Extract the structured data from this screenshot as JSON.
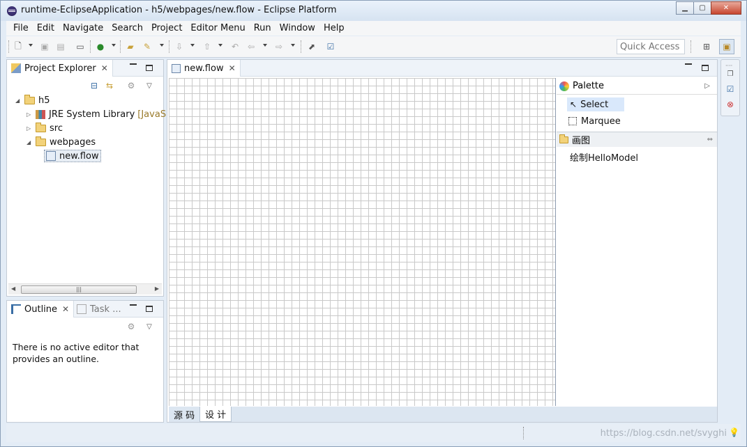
{
  "window": {
    "title": "runtime-EclipseApplication - h5/webpages/new.flow - Eclipse Platform"
  },
  "menu": [
    "File",
    "Edit",
    "Navigate",
    "Search",
    "Project",
    "Editor Menu",
    "Run",
    "Window",
    "Help"
  ],
  "toolbar": {
    "quick_access": "Quick Access"
  },
  "project_explorer": {
    "tab_label": "Project Explorer",
    "tree": {
      "root": "h5",
      "jre": "JRE System Library",
      "jre_decoration": "[JavaSE-",
      "src": "src",
      "webpages": "webpages",
      "file": "new.flow"
    }
  },
  "outline": {
    "tab_label": "Outline",
    "task_tab_label": "Task ...",
    "message": "There is no active editor that provides an outline."
  },
  "editor": {
    "tab_label": "new.flow",
    "palette": {
      "header": "Palette",
      "tools": [
        "Select",
        "Marquee"
      ],
      "drawer_label": "画图",
      "drawer_items": [
        "绘制HelloModel"
      ]
    },
    "bottom_tabs": [
      "源 码",
      "设 计"
    ]
  },
  "status": {
    "watermark": "https://blog.csdn.net/svyghi"
  },
  "colors": {
    "window_bg": "#e3ecf6",
    "grid": "#c9c9c9",
    "palette_selection": "#d9e8fb"
  }
}
